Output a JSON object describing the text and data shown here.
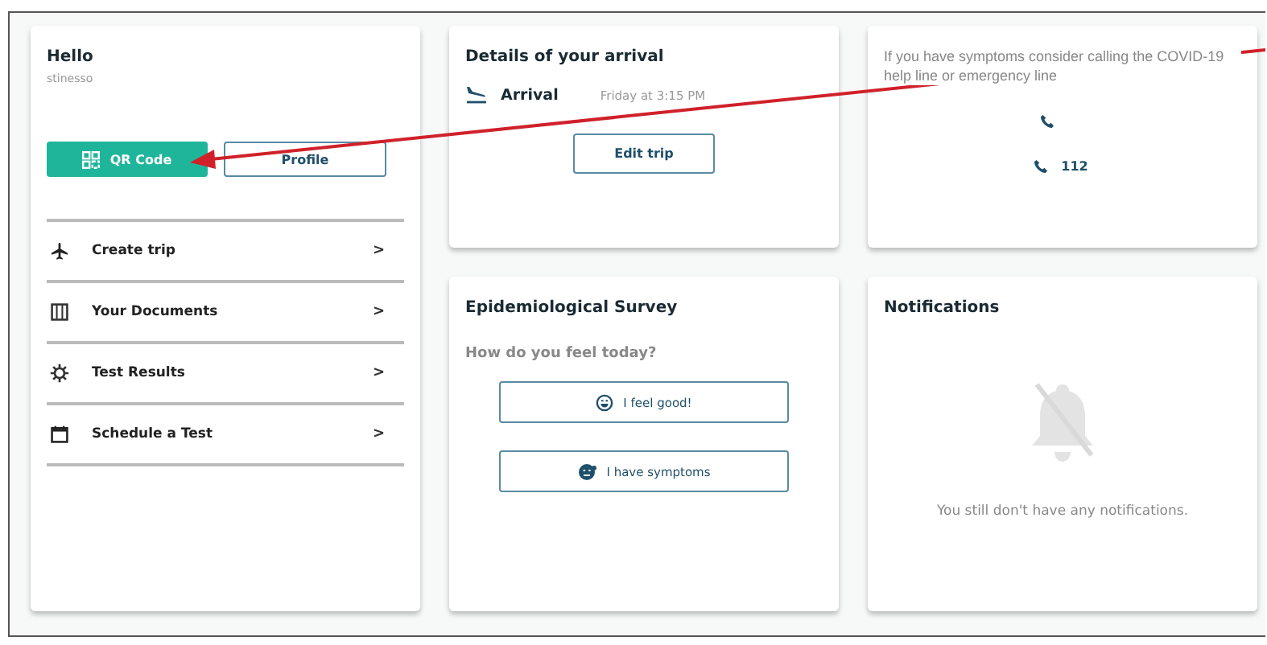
{
  "profile": {
    "greeting": "Hello",
    "username": "stinesso",
    "buttons": [
      {
        "kind": "primary",
        "label": "QR Code"
      },
      {
        "kind": "outline",
        "label": "Profile"
      }
    ],
    "menu": [
      {
        "kind": "plane",
        "label": "Create trip",
        "chevron": ">"
      },
      {
        "kind": "document",
        "label": "Your Documents",
        "chevron": ">"
      },
      {
        "kind": "gear",
        "label": "Test Results",
        "chevron": ">"
      },
      {
        "kind": "calendar",
        "label": "Schedule a Test",
        "chevron": ">"
      }
    ]
  },
  "arrival": {
    "title": "Details of your arrival",
    "label": "Arrival",
    "time": "Friday at 3:15 PM",
    "button": "Edit trip"
  },
  "help": {
    "text": "If you have symptoms consider calling the COVID-19 help line or emergency line",
    "contacts": [
      {
        "kind": "phone-only"
      },
      {
        "kind": "phone",
        "number": "112"
      }
    ]
  },
  "survey": {
    "title": "Epidemiological Survey",
    "question": "How do you feel today?",
    "options": [
      {
        "kind": "good",
        "label": "I feel good!"
      },
      {
        "kind": "symptoms",
        "label": "I have symptoms"
      }
    ]
  },
  "notifications": {
    "title": "Notifications",
    "empty_text": "You still don't have any notifications."
  }
}
